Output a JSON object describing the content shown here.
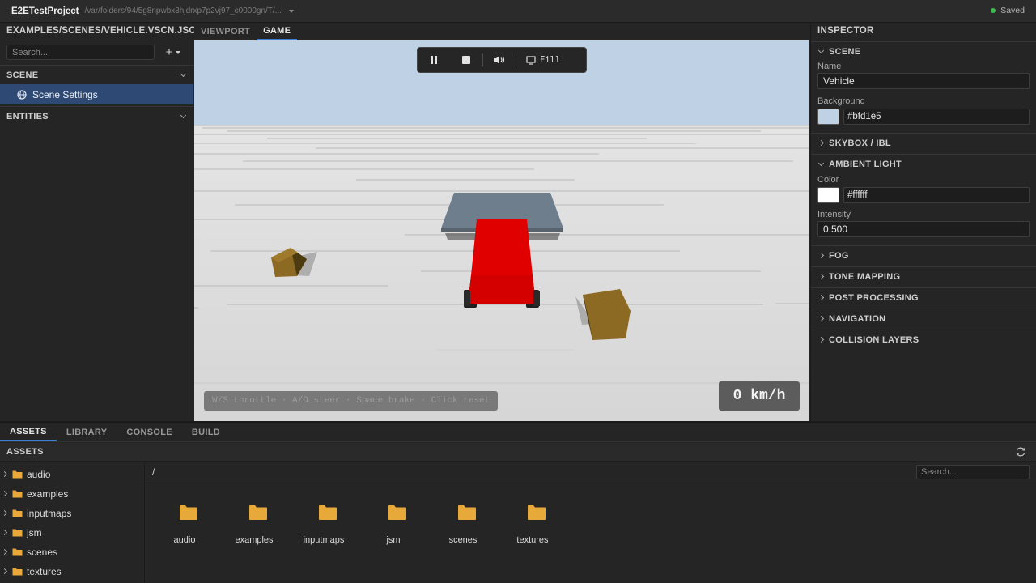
{
  "app": {
    "title": "E2ETestProject",
    "path": "/var/folders/94/5g8npwbx3hjdrxp7p2vj97_c0000gn/T/...",
    "save_status": "Saved",
    "status_color": "#3fb950"
  },
  "left_panel": {
    "file_header": "EXAMPLES/SCENES/VEHICLE.VSCN.JSON",
    "search_placeholder": "Search...",
    "add_icon": "+",
    "scene_section": "SCENE",
    "scene_item": "Scene Settings",
    "entities_section": "ENTITIES"
  },
  "viewport": {
    "tabs": [
      "VIEWPORT",
      "GAME"
    ],
    "active_tab": "GAME",
    "toolbar": {
      "icons": [
        "pause-icon",
        "stop-icon",
        "volume-icon",
        "monitor-icon"
      ],
      "fill_label": "Fill"
    },
    "controls_hint": "W/S throttle · A/D steer · Space brake · Click reset",
    "speed": "0 km/h"
  },
  "inspector": {
    "title": "INSPECTOR",
    "scene_section": "SCENE",
    "name_label": "Name",
    "name_value": "Vehicle",
    "background_label": "Background",
    "background_value": "#bfd1e5",
    "skybox_section": "SKYBOX / IBL",
    "ambient_section": "AMBIENT LIGHT",
    "color_label": "Color",
    "color_value": "#ffffff",
    "intensity_label": "Intensity",
    "intensity_value": "0.500",
    "collapsed_sections": [
      "FOG",
      "TONE MAPPING",
      "POST PROCESSING",
      "NAVIGATION",
      "COLLISION LAYERS"
    ]
  },
  "bottom": {
    "tabs": [
      "ASSETS",
      "LIBRARY",
      "CONSOLE",
      "BUILD"
    ],
    "active_tab": "ASSETS",
    "header": "ASSETS",
    "path": "/",
    "search_placeholder": "Search...",
    "tree": [
      "audio",
      "examples",
      "inputmaps",
      "jsm",
      "scenes",
      "textures"
    ],
    "tiles": [
      "audio",
      "examples",
      "inputmaps",
      "jsm",
      "scenes",
      "textures"
    ]
  },
  "colors": {
    "accent": "#3a7fd5",
    "selection": "#2e4a74",
    "folder": "#e8a93b",
    "sky": "#bfd1e5",
    "vehicle_body": "#e00000",
    "ramp": "#6f7e8c",
    "crate": "#8c6a24"
  }
}
